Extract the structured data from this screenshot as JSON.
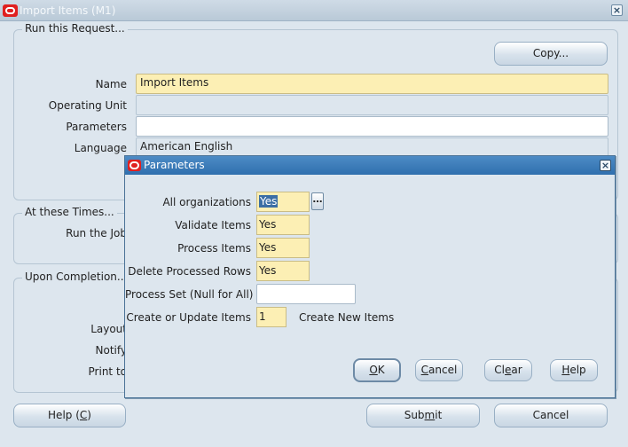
{
  "window": {
    "title": "Import Items (M1)"
  },
  "run_request": {
    "legend": "Run this Request...",
    "copy_label": "Copy...",
    "name_label": "Name",
    "name_value": "Import Items",
    "operating_unit_label": "Operating Unit",
    "operating_unit_value": "",
    "parameters_label": "Parameters",
    "parameters_value": "",
    "language_label": "Language",
    "language_value": "American English"
  },
  "at_these_times": {
    "legend": "At these Times...",
    "run_job_label": "Run the Job"
  },
  "upon_completion": {
    "legend": "Upon Completion...",
    "layout_label": "Layout",
    "notify_label": "Notify",
    "print_label": "Print to"
  },
  "footer": {
    "help": {
      "pre": "Help (",
      "key": "C",
      "post": ")"
    },
    "submit": {
      "pre": "Sub",
      "key": "m",
      "post": "it"
    },
    "cancel": "Cancel"
  },
  "dialog": {
    "title": "Parameters",
    "fields": {
      "all_organizations": {
        "label": "All organizations",
        "value": "Yes"
      },
      "validate_items": {
        "label": "Validate Items",
        "value": "Yes"
      },
      "process_items": {
        "label": "Process Items",
        "value": "Yes"
      },
      "delete_processed_rows": {
        "label": "Delete Processed Rows",
        "value": "Yes"
      },
      "process_set": {
        "label": "Process Set (Null for All)",
        "value": ""
      },
      "create_update_items": {
        "label": "Create or Update Items",
        "value": "1",
        "description": "Create New Items"
      }
    },
    "lov_glyph": "…",
    "buttons": {
      "ok": {
        "key": "O",
        "post": "K"
      },
      "cancel": {
        "key": "C",
        "post": "ancel"
      },
      "clear": {
        "pre": "Cl",
        "key": "e",
        "post": "ar"
      },
      "help": {
        "key": "H",
        "post": "elp"
      }
    }
  },
  "colors": {
    "window_bg": "#dde6ee",
    "required_field": "#fcefb4",
    "dialog_title": "#2f6fae",
    "oracle_red": "#e02020"
  }
}
